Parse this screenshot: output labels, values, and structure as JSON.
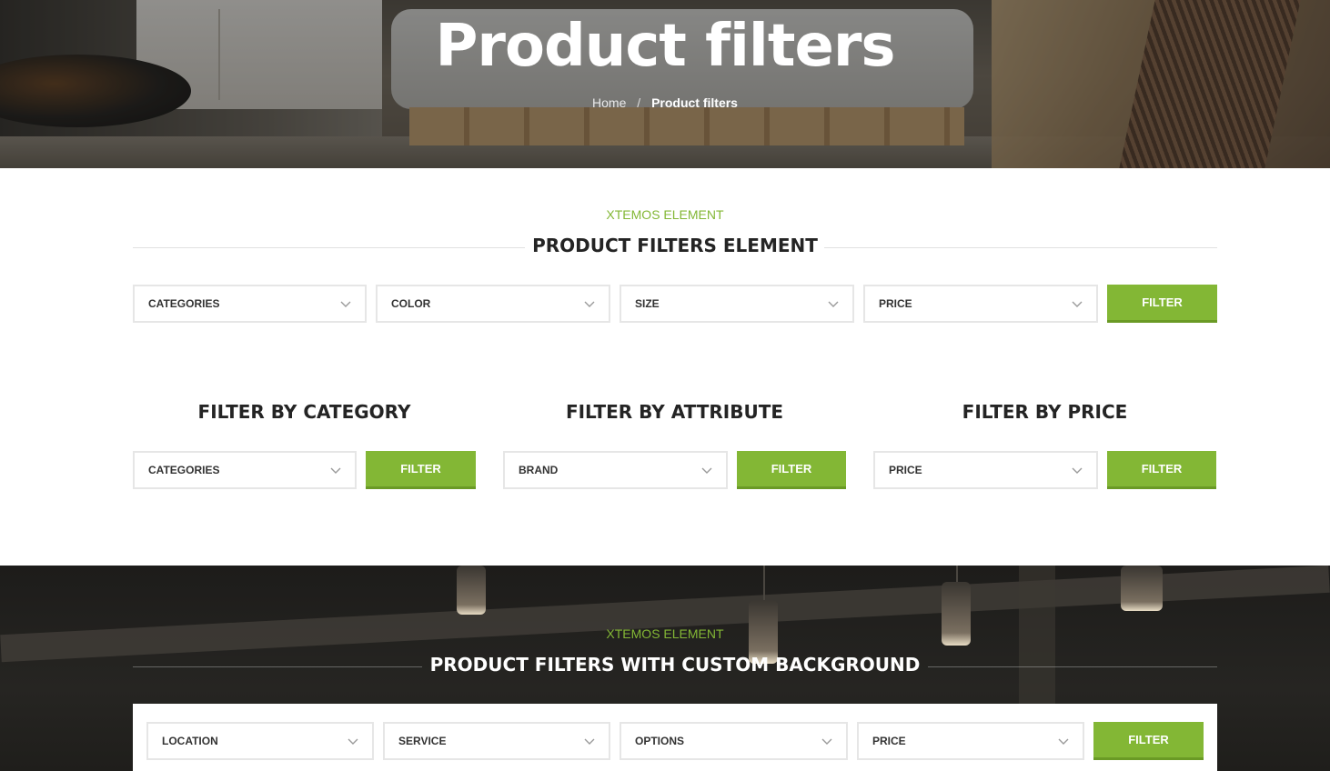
{
  "hero": {
    "title": "Product filters",
    "breadcrumb": {
      "home": "Home",
      "separator": "/",
      "current": "Product filters"
    }
  },
  "section1": {
    "subtitle": "XTEMOS ELEMENT",
    "title": "PRODUCT FILTERS ELEMENT",
    "filters": [
      "CATEGORIES",
      "COLOR",
      "SIZE",
      "PRICE"
    ],
    "button": "FILTER"
  },
  "section2": {
    "columns": [
      {
        "title": "FILTER BY CATEGORY",
        "select": "CATEGORIES",
        "button": "FILTER"
      },
      {
        "title": "FILTER BY ATTRIBUTE",
        "select": "BRAND",
        "button": "FILTER"
      },
      {
        "title": "FILTER BY PRICE",
        "select": "PRICE",
        "button": "FILTER"
      }
    ]
  },
  "section3": {
    "subtitle": "XTEMOS ELEMENT",
    "title": "PRODUCT FILTERS WITH CUSTOM BACKGROUND",
    "filters": [
      "LOCATION",
      "SERVICE",
      "OPTIONS",
      "PRICE"
    ],
    "button": "FILTER"
  },
  "colors": {
    "accent": "#83b735",
    "accent_dark": "#6a9a25",
    "text": "#242424",
    "border": "#e6e6e6"
  },
  "icons": {
    "dropdown": "chevron-down-icon"
  }
}
